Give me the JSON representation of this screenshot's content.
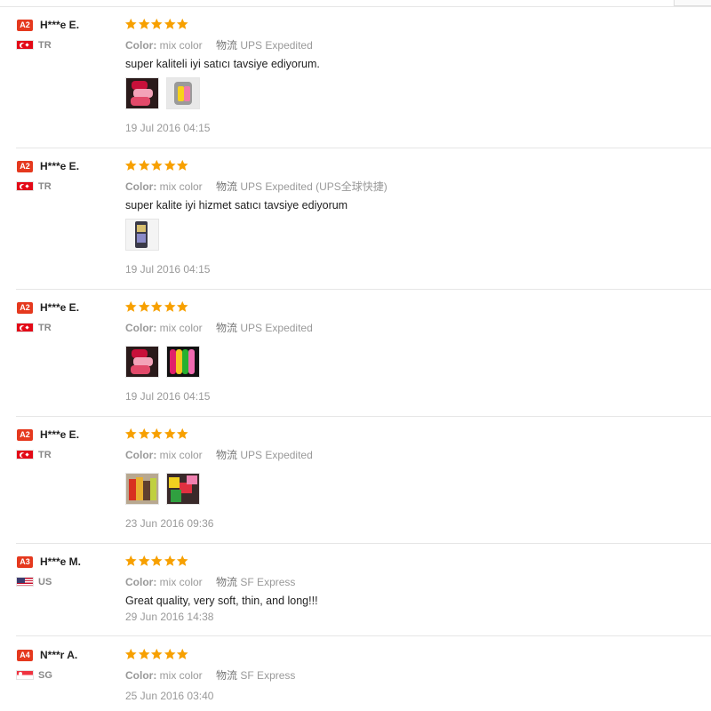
{
  "labels": {
    "color_key": "Color:",
    "ship_key": "物流"
  },
  "star_color": "#f7a000",
  "level_color": "#e5391e",
  "feedbacks": [
    {
      "level": "A2",
      "name": "H***e E.",
      "country": "TR",
      "flag": "turkey-flag-icon",
      "rating": 5,
      "color": "mix color",
      "shipping": "UPS Expedited",
      "text": "super kaliteli iyi satıcı tavsiye ediyorum.",
      "photos": [
        "photo-thumbnail",
        "photo-thumbnail"
      ],
      "date": "19 Jul 2016 04:15"
    },
    {
      "level": "A2",
      "name": "H***e E.",
      "country": "TR",
      "flag": "turkey-flag-icon",
      "rating": 5,
      "color": "mix color",
      "shipping": "UPS Expedited (UPS全球快捷)",
      "text": "super kalite iyi hizmet satıcı tavsiye ediyorum",
      "photos": [
        "photo-thumbnail"
      ],
      "date": "19 Jul 2016 04:15"
    },
    {
      "level": "A2",
      "name": "H***e E.",
      "country": "TR",
      "flag": "turkey-flag-icon",
      "rating": 5,
      "color": "mix color",
      "shipping": "UPS Expedited",
      "text": "",
      "photos": [
        "photo-thumbnail",
        "photo-thumbnail"
      ],
      "date": "19 Jul 2016 04:15"
    },
    {
      "level": "A2",
      "name": "H***e E.",
      "country": "TR",
      "flag": "turkey-flag-icon",
      "rating": 5,
      "color": "mix color",
      "shipping": "UPS Expedited",
      "text": "",
      "photos": [
        "photo-thumbnail",
        "photo-thumbnail"
      ],
      "date": "23 Jun 2016 09:36"
    },
    {
      "level": "A3",
      "name": "H***e M.",
      "country": "US",
      "flag": "usa-flag-icon",
      "rating": 5,
      "color": "mix color",
      "shipping": "SF Express",
      "text": "Great quality, very soft, thin, and long!!!",
      "photos": [],
      "date": "29 Jun 2016 14:38"
    },
    {
      "level": "A4",
      "name": "N***r A.",
      "country": "SG",
      "flag": "singapore-flag-icon",
      "rating": 5,
      "color": "mix color",
      "shipping": "SF Express",
      "text": "",
      "photos": [],
      "date": "25 Jun 2016 03:40"
    }
  ]
}
